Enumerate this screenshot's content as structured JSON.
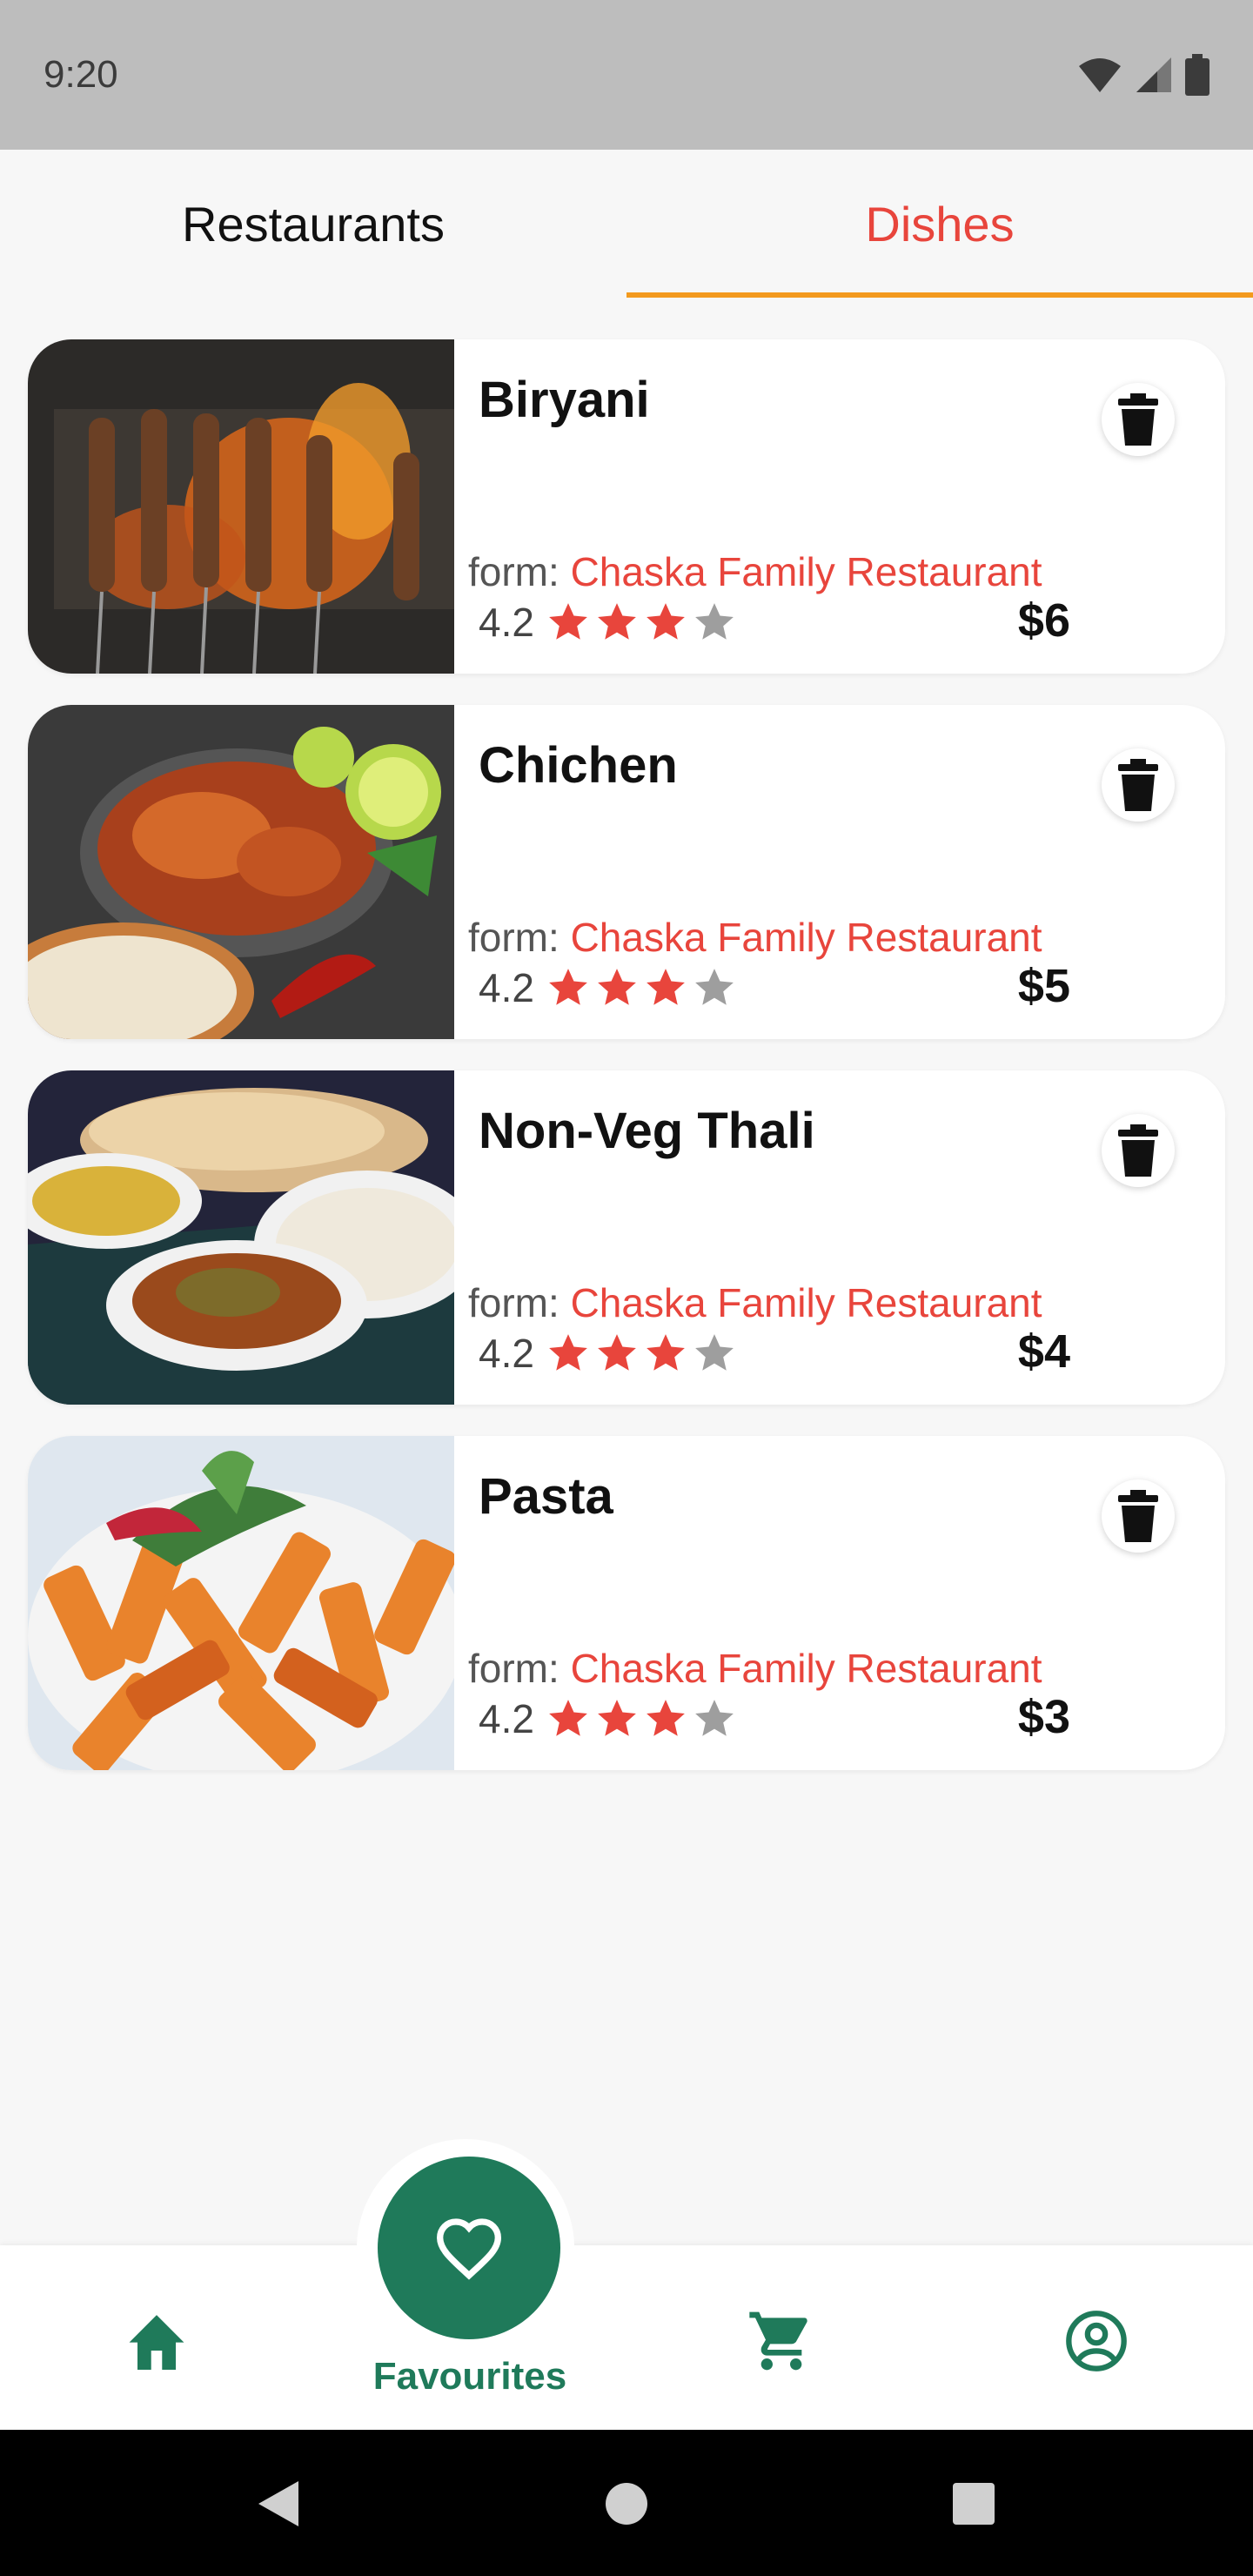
{
  "status_bar": {
    "time": "9:20"
  },
  "tabs": [
    {
      "label": "Restaurants",
      "active": false
    },
    {
      "label": "Dishes",
      "active": true
    }
  ],
  "colors": {
    "accent": "#e8453c",
    "tab_indicator": "#f39a1e",
    "primary": "#1f7a5a",
    "star_filled": "#e8453c",
    "star_empty": "#9e9e9e"
  },
  "dishes": [
    {
      "name": "Biryani",
      "from_label": "form:",
      "restaurant": "Chaska Family Restaurant",
      "rating": "4.2",
      "stars": 3,
      "price": "$6",
      "image": "skewers-on-grill"
    },
    {
      "name": "Chichen",
      "from_label": "form:",
      "restaurant": "Chaska Family Restaurant",
      "rating": "4.2",
      "stars": 3,
      "price": "$5",
      "image": "chicken-curry"
    },
    {
      "name": "Non-Veg Thali",
      "from_label": "form:",
      "restaurant": "Chaska Family Restaurant",
      "rating": "4.2",
      "stars": 3,
      "price": "$4",
      "image": "thali-platter"
    },
    {
      "name": "Pasta",
      "from_label": "form:",
      "restaurant": "Chaska Family Restaurant",
      "rating": "4.2",
      "stars": 3,
      "price": "$3",
      "image": "penne-pasta"
    }
  ],
  "bottom_nav": {
    "items": [
      {
        "icon": "home-icon"
      },
      {
        "icon": "heart-icon",
        "label": "Favourites",
        "active": true
      },
      {
        "icon": "cart-icon"
      },
      {
        "icon": "profile-icon"
      }
    ]
  }
}
